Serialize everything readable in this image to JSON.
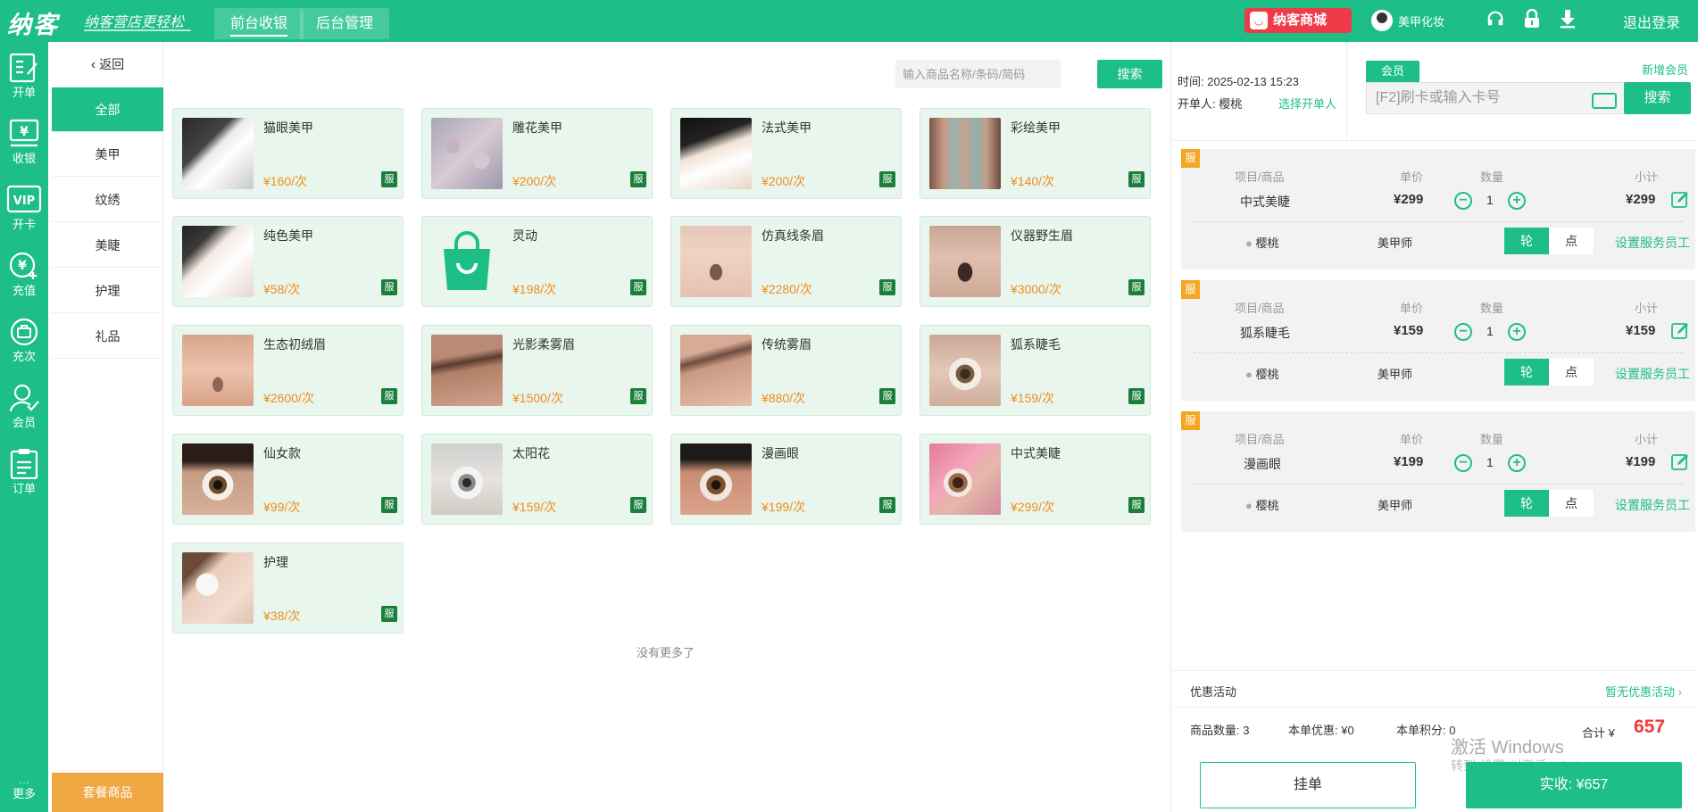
{
  "topbar": {
    "logo": "纳客",
    "slogan": "纳客营店更轻松",
    "tabs": [
      "前台收银",
      "后台管理"
    ],
    "mall": "纳客商城",
    "username": "美甲化妆",
    "logout": "退出登录",
    "icons": [
      "headset-icon",
      "lock-icon",
      "download-icon"
    ]
  },
  "leftnav": {
    "items": [
      "开单",
      "收银",
      "开卡",
      "充值",
      "充次",
      "会员",
      "订单"
    ],
    "more": "更多"
  },
  "catnav": {
    "back": "返回",
    "categories": [
      "全部",
      "美甲",
      "纹绣",
      "美睫",
      "护理",
      "礼品"
    ],
    "package": "套餐商品"
  },
  "search": {
    "placeholder": "输入商品名称/条码/简码",
    "button": "搜索"
  },
  "products": [
    {
      "name": "猫眼美甲",
      "price": "¥160/次",
      "tag": "服"
    },
    {
      "name": "雕花美甲",
      "price": "¥200/次",
      "tag": "服"
    },
    {
      "name": "法式美甲",
      "price": "¥200/次",
      "tag": "服"
    },
    {
      "name": "彩绘美甲",
      "price": "¥140/次",
      "tag": "服"
    },
    {
      "name": "纯色美甲",
      "price": "¥58/次",
      "tag": "服"
    },
    {
      "name": "灵动",
      "price": "¥198/次",
      "tag": "服"
    },
    {
      "name": "仿真线条眉",
      "price": "¥2280/次",
      "tag": "服"
    },
    {
      "name": "仪器野生眉",
      "price": "¥3000/次",
      "tag": "服"
    },
    {
      "name": "生态初绒眉",
      "price": "¥2600/次",
      "tag": "服"
    },
    {
      "name": "光影柔雾眉",
      "price": "¥1500/次",
      "tag": "服"
    },
    {
      "name": "传统雾眉",
      "price": "¥880/次",
      "tag": "服"
    },
    {
      "name": "狐系睫毛",
      "price": "¥159/次",
      "tag": "服"
    },
    {
      "name": "仙女款",
      "price": "¥99/次",
      "tag": "服"
    },
    {
      "name": "太阳花",
      "price": "¥159/次",
      "tag": "服"
    },
    {
      "name": "漫画眼",
      "price": "¥199/次",
      "tag": "服"
    },
    {
      "name": "中式美睫",
      "price": "¥299/次",
      "tag": "服"
    },
    {
      "name": "护理",
      "price": "¥38/次",
      "tag": "服"
    }
  ],
  "no_more": "没有更多了",
  "order": {
    "time_label": "时间:",
    "time": "2025-02-13 15:23",
    "opener_label": "开单人:",
    "opener": "樱桃",
    "select_opener": "选择开单人",
    "member_tab": "会员",
    "add_member": "新增会员",
    "card_placeholder": "[F2]刷卡或输入卡号",
    "search": "搜索",
    "headers": {
      "item": "项目/商品",
      "price": "单价",
      "qty": "数量",
      "subtotal": "小计"
    },
    "items": [
      {
        "badge": "服",
        "name": "中式美睫",
        "price": "¥299",
        "qty": "1",
        "subtotal": "¥299",
        "staff": "樱桃",
        "role": "美甲师",
        "lun": "轮",
        "dian": "点",
        "set_staff": "设置服务员工"
      },
      {
        "badge": "服",
        "name": "狐系睫毛",
        "price": "¥159",
        "qty": "1",
        "subtotal": "¥159",
        "staff": "樱桃",
        "role": "美甲师",
        "lun": "轮",
        "dian": "点",
        "set_staff": "设置服务员工"
      },
      {
        "badge": "服",
        "name": "漫画眼",
        "price": "¥199",
        "qty": "1",
        "subtotal": "¥199",
        "staff": "樱桃",
        "role": "美甲师",
        "lun": "轮",
        "dian": "点",
        "set_staff": "设置服务员工"
      }
    ],
    "promo_label": "优惠活动",
    "promo_value": "暂无优惠活动",
    "count_label": "商品数量:",
    "count": "3",
    "discount_label": "本单优惠:",
    "discount": "¥0",
    "points_label": "本单积分:",
    "points": "0",
    "total_label": "合计 ¥",
    "total": "657",
    "hold": "挂单",
    "pay": "实收:  ¥657"
  },
  "watermark": {
    "line1": "激活 Windows",
    "line2": "转到\"设置\"以激活 Windows。"
  },
  "colors": {
    "primary": "#1dbf86",
    "price": "#ef8d1f",
    "badge": "#f5a623",
    "total": "#ef3a3a",
    "mall": "#ef3a4a",
    "package": "#f0a845"
  }
}
